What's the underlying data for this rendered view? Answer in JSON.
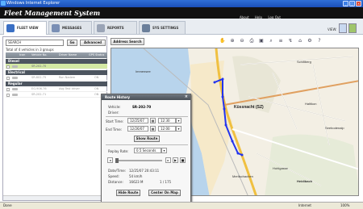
{
  "window": {
    "title": "Windows Internet Explorer"
  },
  "app": {
    "title": "Fleet Management System",
    "links": [
      "About",
      "Help",
      "Log Out"
    ]
  },
  "tabs": [
    {
      "label": "FLEET VIEW",
      "active": true,
      "color": "#3a6fc4"
    },
    {
      "label": "MESSAGES",
      "active": false,
      "color": "#7a8fb5"
    },
    {
      "label": "REPORTS",
      "active": false,
      "color": "#9aa4b6"
    },
    {
      "label": "SYS SETTINGS",
      "active": false,
      "color": "#6b7f9a"
    }
  ],
  "view": {
    "label": "VIEW:"
  },
  "left": {
    "search_placeholder": "SEARCH",
    "go": "Go",
    "advanced": "Advanced",
    "total": "Total of 4 vehicles in 3 groups",
    "columns": [
      "Icon",
      "Vehicle No.",
      "Driver Name",
      "GPS Status"
    ],
    "groups": [
      {
        "name": "Diesel",
        "rows": [
          {
            "vehicle": "SR-202-70",
            "driver": "",
            "status": "",
            "highlight": true
          }
        ]
      },
      {
        "name": "Electrical",
        "rows": [
          {
            "vehicle": "SR-802-75",
            "driver": "Ron Nadem",
            "status": "ON"
          }
        ]
      },
      {
        "name": "Regular",
        "rows": [
          {
            "vehicle": "EG-906-76",
            "driver": "Avg Test driver",
            "status": "ON"
          },
          {
            "vehicle": "SR-202-71",
            "driver": "",
            "status": "ON"
          }
        ]
      }
    ]
  },
  "map": {
    "address_search": "Address Search",
    "tool_icons": [
      "hand-icon",
      "zoom-in-icon",
      "zoom-out-icon",
      "print-icon",
      "save-icon",
      "search-icon",
      "layers-icon",
      "route-icon",
      "home-icon",
      "settings-icon",
      "help-icon"
    ],
    "places": [
      "Schiltberg",
      "Küssnacht (SZ)",
      "Immensee",
      "Haltikon",
      "Seebodenalp",
      "Hohlgasse",
      "Merlischachen",
      "Heidibach"
    ],
    "route_color": "#2233ee"
  },
  "route_history": {
    "title": "Route History",
    "vehicle_label": "Vehicle:",
    "vehicle_value": "SR-202-70",
    "driver_label": "Driver:",
    "driver_value": "",
    "start_label": "Start Time:",
    "start_date": "12/25/07",
    "start_time": "12:30",
    "end_label": "End Time:",
    "end_date": "12/26/07",
    "end_time": "12:00",
    "show_route": "Show Route",
    "replay_label": "Replay Rate:",
    "replay_value": "0.5 Seconds",
    "date_label": "Date/Time:",
    "date_value": "12/25/07 20:43:11",
    "speed_label": "Speed:",
    "speed_value": "54 km/h",
    "distance_label": "Distance:",
    "distance_value": "16623 M",
    "progress": "1 / 175",
    "hide_route": "Hide Route",
    "center_on_map": "Center On Map"
  },
  "status": {
    "left": "Done",
    "zone": "Internet",
    "zoom": "100%"
  }
}
